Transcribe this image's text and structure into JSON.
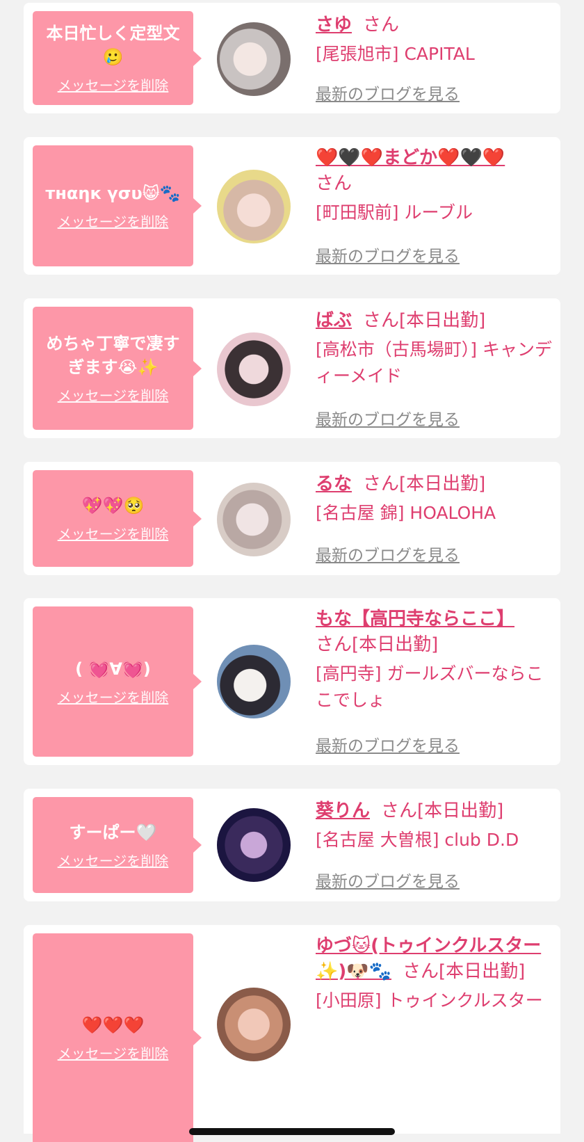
{
  "delete_label": "メッセージを削除",
  "blog_label": "最新のブログを見る",
  "san_label": "さん",
  "colors": {
    "bubble": "#fd97a8",
    "name": "#de3e6f",
    "link": "#8a8a8a",
    "background": "#f2f2f2"
  },
  "items": [
    {
      "message": "本日忙しく定型文\n🥲",
      "name": "さゆ",
      "suffix": "",
      "shop": "[尾張旭市] CAPITAL"
    },
    {
      "message": "тнαηк үσυ😸🐾",
      "name": "❤️🖤❤️まどか❤️🖤❤️",
      "suffix": "",
      "shop": "[町田駅前] ルーブル"
    },
    {
      "message": "めちゃ丁寧で凄す\nぎます😭✨",
      "name": "ばぶ",
      "suffix": "[本日出勤]",
      "shop": "[高松市（古馬場町）] キャンディーメイド"
    },
    {
      "message": "💖💖🥺",
      "name": "るな",
      "suffix": "[本日出勤]",
      "shop": "[名古屋 錦] HOALOHA"
    },
    {
      "message": "( 💓∀💓)",
      "name": "もな【高円寺ならここ】",
      "suffix": "[本日出勤]",
      "shop": "[高円寺] ガールズバーならここでしょ"
    },
    {
      "message": "すーぱー🤍",
      "name": "葵りん",
      "suffix": "[本日出勤]",
      "shop": "[名古屋 大曽根] club D.D"
    },
    {
      "message": "❤️❤️❤️",
      "name": "ゆづ🐱(トゥインクルスター✨)🐶🐾",
      "suffix": "[本日出勤]",
      "shop": "[小田原] トゥインクルスター"
    }
  ]
}
